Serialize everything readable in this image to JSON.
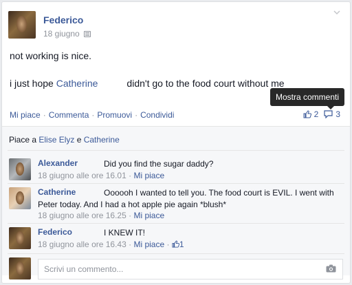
{
  "post": {
    "author": "Federico",
    "date": "18 giugno",
    "line1": "not working is nice.",
    "line2_prefix": "i just hope ",
    "line2_link": "Catherine",
    "line2_suffix": "didn't go to the food court without me"
  },
  "tooltip": "Mostra commenti",
  "actions": {
    "like": "Mi piace",
    "comment": "Commenta",
    "promote": "Promuovi",
    "share": "Condividi",
    "like_count": "2",
    "comment_count": "3"
  },
  "likes": {
    "prefix": "Piace a ",
    "person1": "Elise Elyz",
    "conj": " e ",
    "person2": "Catherine"
  },
  "comments": [
    {
      "name": "Alexander",
      "text": "Did you find the sugar daddy?",
      "time": "18 giugno alle ore 16.01",
      "like": "Mi piace"
    },
    {
      "name": "Catherine",
      "text_line1": "Oooooh I wanted to tell you. The food court is EVIL. I went with",
      "text_line2": "Peter today. And I had a hot apple pie again *blush*",
      "time": "18 giugno alle ore 16.25",
      "like": "Mi piace"
    },
    {
      "name": "Federico",
      "text": "I KNEW IT!",
      "time": "18 giugno alle ore 16.43",
      "like": "Mi piace",
      "likes": "1"
    }
  ],
  "composer": {
    "placeholder": "Scrivi un commento..."
  },
  "colors": {
    "link": "#3b5998",
    "muted": "#90949c",
    "tooltip_bg": "#282828"
  }
}
